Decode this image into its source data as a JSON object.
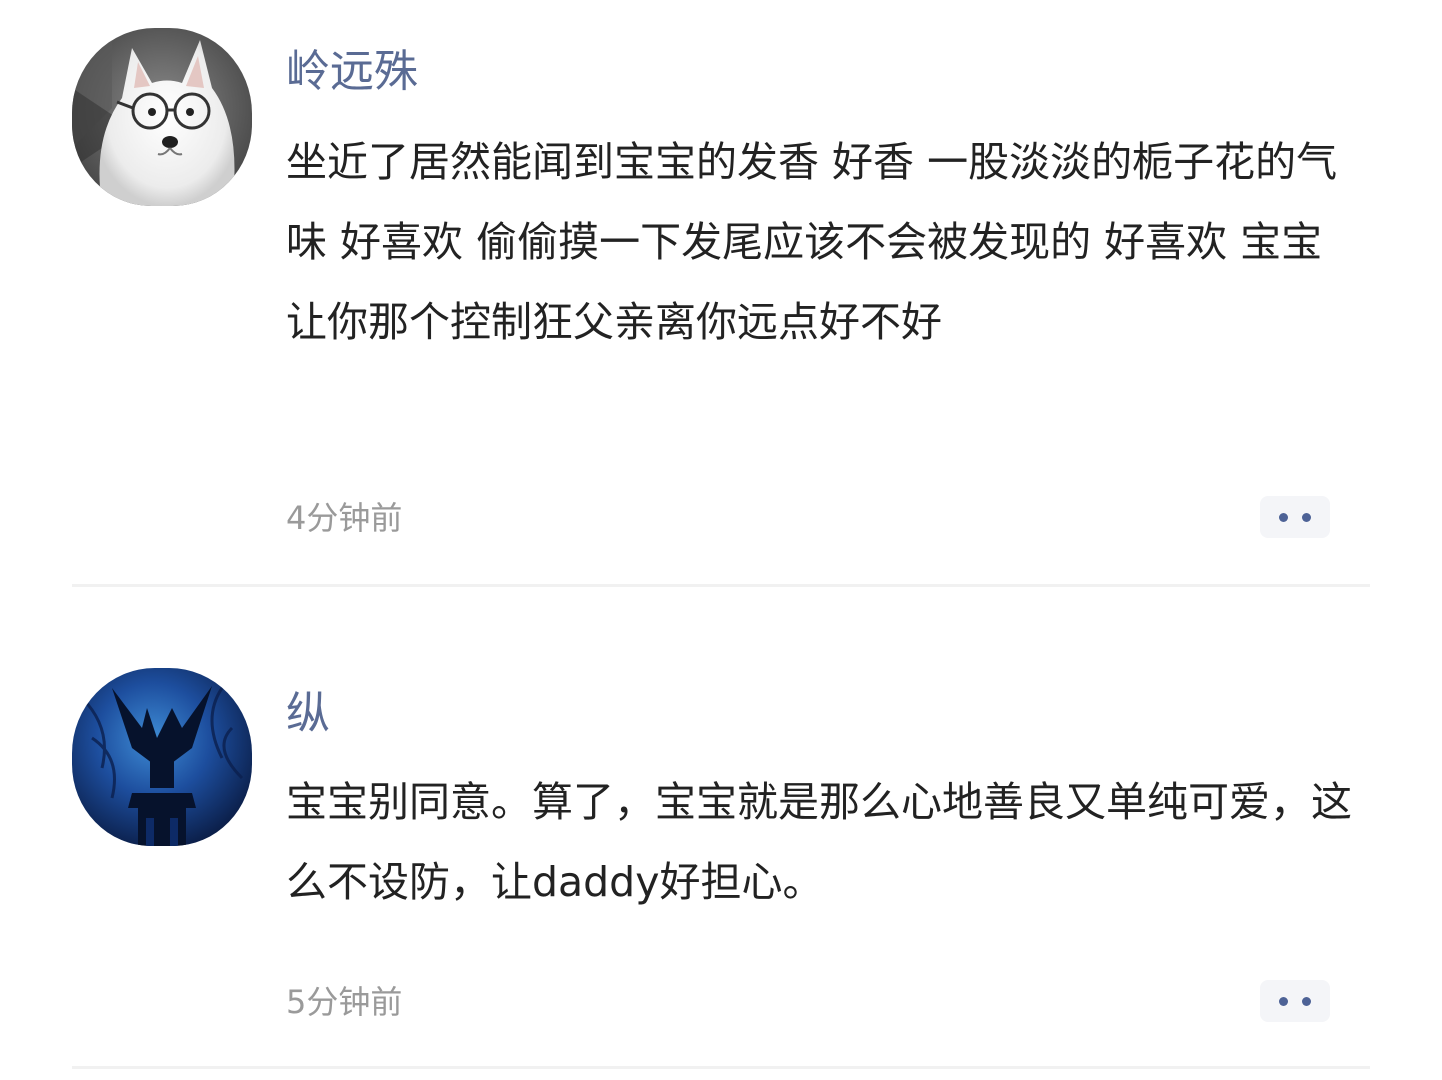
{
  "comments": [
    {
      "avatar_icon": "samoyed-with-glasses-avatar",
      "username": "岭远殊",
      "text": "坐近了居然能闻到宝宝的发香  好香  一股淡淡的栀子花的气味  好喜欢  偷偷摸一下发尾应该不会被发现的  好喜欢  宝宝  让你那个控制狂父亲离你远点好不好",
      "time": "4分钟前",
      "more_icon": "more-dots-icon"
    },
    {
      "avatar_icon": "dark-blue-statue-avatar",
      "username": "纵",
      "text": "宝宝别同意。算了，宝宝就是那么心地善良又单纯可爱，这么不设防，让daddy好担心。",
      "time": "5分钟前",
      "more_icon": "more-dots-icon"
    }
  ],
  "colors": {
    "username": "#5a6b94",
    "text": "#222222",
    "timestamp": "#9a9a9a",
    "more_dots": "#4d6296",
    "more_bg": "#f4f5f8",
    "divider": "#f1f1f1"
  }
}
